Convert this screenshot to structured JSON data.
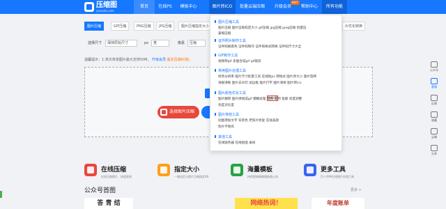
{
  "header": {
    "logo_title": "压缩图",
    "logo_sub": "yasuotu.com",
    "nav": [
      "首页",
      "在线PS",
      "模板中心",
      "图片转ICO",
      "批量云端压缩",
      "升级会员",
      "帮助中心",
      "所有功能"
    ],
    "hot_badge": "HOT"
  },
  "tabs": [
    "图片压缩",
    "GIF压缩",
    "PNG压缩",
    "JPG压缩",
    "图片压缩指定大小"
  ],
  "tab_tail": "片优化转换",
  "controls": {
    "target_label": "选择尺寸",
    "target_value": "保持原始尺寸",
    "px_label": "px",
    "px_placeholder": "宽",
    "unit_label": "像素",
    "compress_label": "压缩"
  },
  "notice": {
    "text": "温馨提示：1.单次单张图片最大支持50M。",
    "vip": "升级会员",
    "tail": "最多压缩60张。"
  },
  "upload": {
    "select_button": "选择图片压缩"
  },
  "side": [
    "公众号",
    "客服",
    "反馈",
    "收藏",
    "云端",
    "分享"
  ],
  "features": [
    {
      "title": "在线压缩",
      "desc": "在线压缩图片，快速高效",
      "color": "#e8473d"
    },
    {
      "title": "指定大小",
      "desc": "一键自定义图片压缩指定KB",
      "color": "#ff9f1a"
    },
    {
      "title": "海量模板",
      "desc": "持续更新精美模板随心选",
      "color": "#27a344"
    },
    {
      "title": "更多工具",
      "desc": "百十余种在线图片处理工具",
      "color": "#3a63f3"
    }
  ],
  "section": {
    "title": "公众号首图",
    "more": "更多 >"
  },
  "thumbs": [
    "答 青 结",
    "年度账单",
    "网络热词！"
  ],
  "dropdown": {
    "groups": [
      {
        "title": "图片压缩工具",
        "lines": [
          "图片压缩   图片压缩指定大小   gif压缩   jpg压缩   jpeg压缩   批量压",
          "缩",
          "兼缩压缩"
        ]
      },
      {
        "title": "证件照片制作工具",
        "lines": [
          "证件照换底色   证件照制作   证件照格式转换   证件照尺寸大全"
        ]
      },
      {
        "title": "GIF制作工具",
        "lines": [
          "视频转gif   多图合成gif   gif裁剪"
        ]
      },
      {
        "title": "常用图片处理工具",
        "lines": [
          "修改分辨率   图片尺寸批量工具   在线抠ps   转格式   图片改大小   图片旋转",
          "海报清晰   图片去水印   加边框   图片打字   图片清晰   图片转ico"
        ]
      },
      {
        "title": "图片颜色优化工具",
        "lines": [
          "图片翻转   图片拼接成gif   模糊处理   反色   透明   鱼眼   亮度调整",
          "亮度对比度"
        ]
      },
      {
        "title": "图片特效工具",
        "lines": [
          "动图添加文字   背景色   老照片修复   在线美颜",
          "照片不够亮"
        ]
      },
      {
        "title": "其他工具",
        "lines": [
          "在线取色器   在线抠图   录屏"
        ]
      }
    ],
    "highlight": "拍分切"
  }
}
